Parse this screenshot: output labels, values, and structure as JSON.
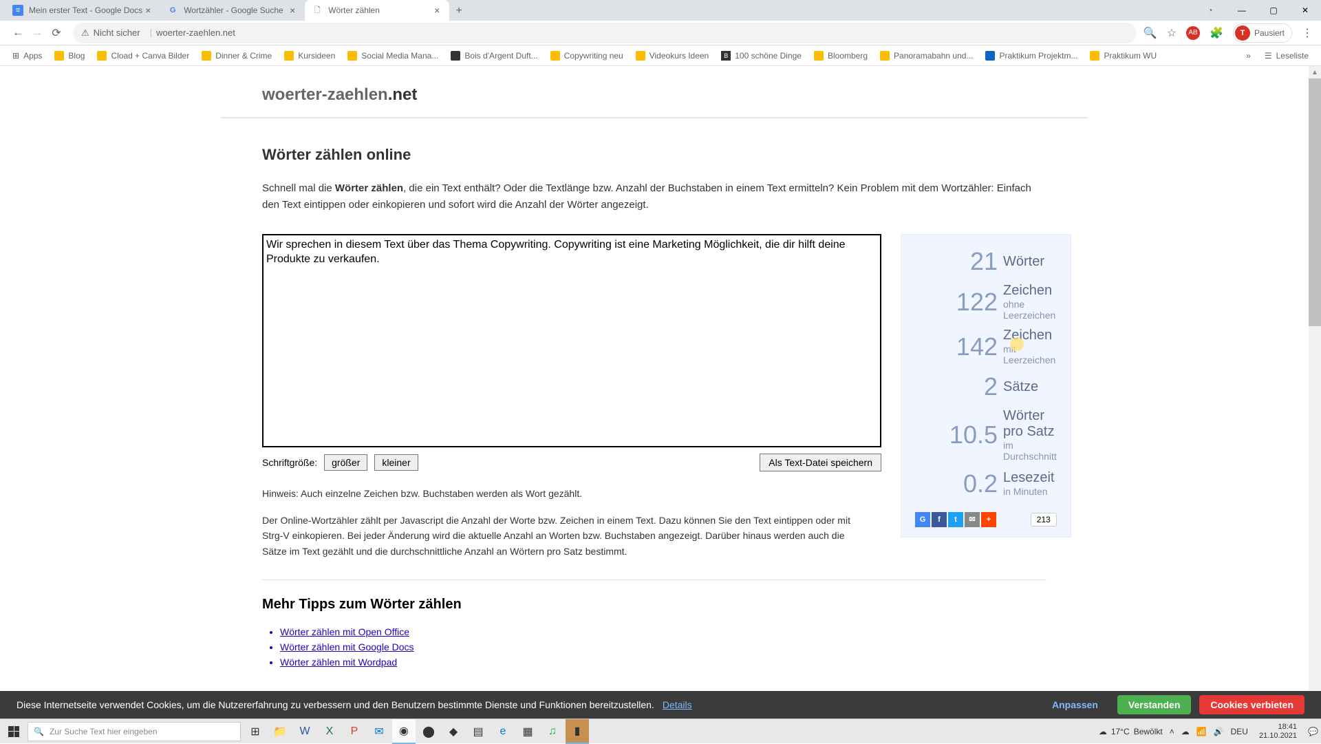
{
  "browser": {
    "tabs": [
      {
        "title": "Mein erster Text - Google Docs",
        "favicon_bg": "#4285f4",
        "favicon_char": "≡"
      },
      {
        "title": "Wortzähler - Google Suche",
        "favicon_bg": "#fff",
        "favicon_char": "G"
      },
      {
        "title": "Wörter zählen",
        "favicon_bg": "#fff",
        "favicon_char": "○",
        "active": true
      }
    ],
    "url": "woerter-zaehlen.net",
    "security_label": "Nicht sicher",
    "profile_state": "Pausiert",
    "profile_initial": "T",
    "bookmarks": [
      "Apps",
      "Blog",
      "Cload + Canva Bilder",
      "Dinner & Crime",
      "Kursideen",
      "Social Media Mana...",
      "Bois d'Argent Duft...",
      "Copywriting neu",
      "Videokurs Ideen",
      "100 schöne Dinge",
      "Bloomberg",
      "Panoramabahn und...",
      "Praktikum Projektm...",
      "Praktikum WU"
    ],
    "readlist_label": "Leseliste"
  },
  "page": {
    "logo_main": "woerter-zaehlen",
    "logo_tld": ".net",
    "h1": "Wörter zählen online",
    "intro_pre": "Schnell mal die ",
    "intro_bold": "Wörter zählen",
    "intro_post": ", die ein Text enthält? Oder die Textlänge bzw. Anzahl der Buchstaben in einem Text ermitteln? Kein Problem mit dem Wortzähler: Einfach den Text eintippen oder einkopieren und sofort wird die Anzahl der Wörter angezeigt.",
    "textarea_value": "Wir sprechen in diesem Text über das Thema Copywriting. Copywriting ist eine Marketing Möglichkeit, die dir hilft deine Produkte zu verkaufen.",
    "font_size_label": "Schriftgröße:",
    "btn_bigger": "größer",
    "btn_smaller": "kleiner",
    "btn_save": "Als Text-Datei speichern",
    "hint": "Hinweis: Auch einzelne Zeichen bzw. Buchstaben werden als Wort gezählt.",
    "desc": "Der Online-Wortzähler zählt per Javascript die Anzahl der Worte bzw. Zeichen in einem Text. Dazu können Sie den Text eintippen oder mit Strg-V einkopieren. Bei jeder Änderung wird die aktuelle Anzahl an Worten bzw. Buchstaben angezeigt. Darüber hinaus werden auch die Sätze im Text gezählt und die durchschnittliche Anzahl an Wörtern pro Satz bestimmt.",
    "stats": {
      "words_n": "21",
      "words_l": "Wörter",
      "chars_no_n": "122",
      "chars_no_l": "Zeichen",
      "chars_no_s": "ohne Leerzeichen",
      "chars_w_n": "142",
      "chars_w_l": "Zeichen",
      "chars_w_s": "mit Leerzeichen",
      "sent_n": "2",
      "sent_l": "Sätze",
      "wps_n": "10.5",
      "wps_l": "Wörter pro Satz",
      "wps_s": "im Durchschnitt",
      "read_n": "0.2",
      "read_l": "Lesezeit",
      "read_s": "in Minuten"
    },
    "share_count": "213",
    "h2": "Mehr Tipps zum Wörter zählen",
    "tips": [
      "Wörter zählen mit Open Office",
      "Wörter zählen mit Google Docs",
      "Wörter zählen mit Wordpad"
    ]
  },
  "cookie": {
    "text": "Diese Internetseite verwendet Cookies, um die Nutzererfahrung zu verbessern und den Benutzern bestimmte Dienste und Funktionen bereitzustellen.",
    "details": "Details",
    "anpassen": "Anpassen",
    "verstanden": "Verstanden",
    "verbieten": "Cookies verbieten"
  },
  "taskbar": {
    "search_placeholder": "Zur Suche Text hier eingeben",
    "weather_temp": "17°C",
    "weather_desc": "Bewölkt",
    "lang": "DEU",
    "time": "18:41",
    "date": "21.10.2021"
  }
}
